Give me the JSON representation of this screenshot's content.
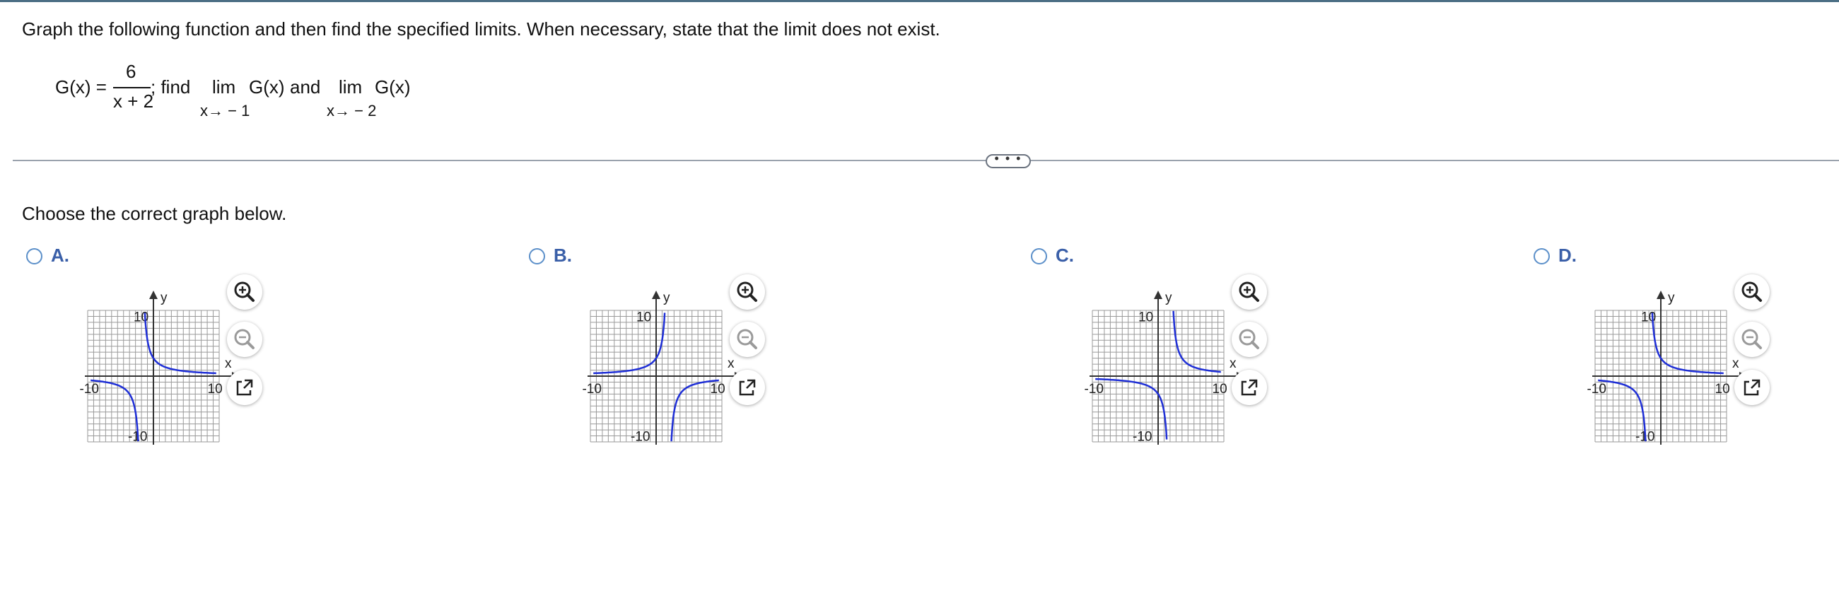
{
  "question": {
    "instruction": "Graph the following function and then find the specified limits. When necessary, state that the limit does not exist.",
    "func_name": "G(x) =",
    "numerator": "6",
    "denominator": "x + 2",
    "find_text": "; find",
    "lim1": "lim",
    "lim1_expr": "G(x)",
    "lim1_sub": "x→ − 1",
    "and_text": "and",
    "lim2": "lim",
    "lim2_expr": "G(x)",
    "lim2_sub": "x→ − 2"
  },
  "divider_button": "• • •",
  "prompt": "Choose the correct graph below.",
  "options": [
    {
      "letter": "A.",
      "variant": "A"
    },
    {
      "letter": "B.",
      "variant": "B"
    },
    {
      "letter": "C.",
      "variant": "C"
    },
    {
      "letter": "D.",
      "variant": "D"
    }
  ],
  "axis": {
    "x_label": "x",
    "y_label": "y",
    "pos_tick": "10",
    "neg_tick": "-10"
  },
  "colors": {
    "curve": "#1f2fd6",
    "grid": "#9a9a9a",
    "option_letter": "#3a5fa8",
    "radio": "#5b8fc9"
  },
  "tools": [
    "zoom-in-icon",
    "zoom-out-icon",
    "open-new-window-icon"
  ]
}
